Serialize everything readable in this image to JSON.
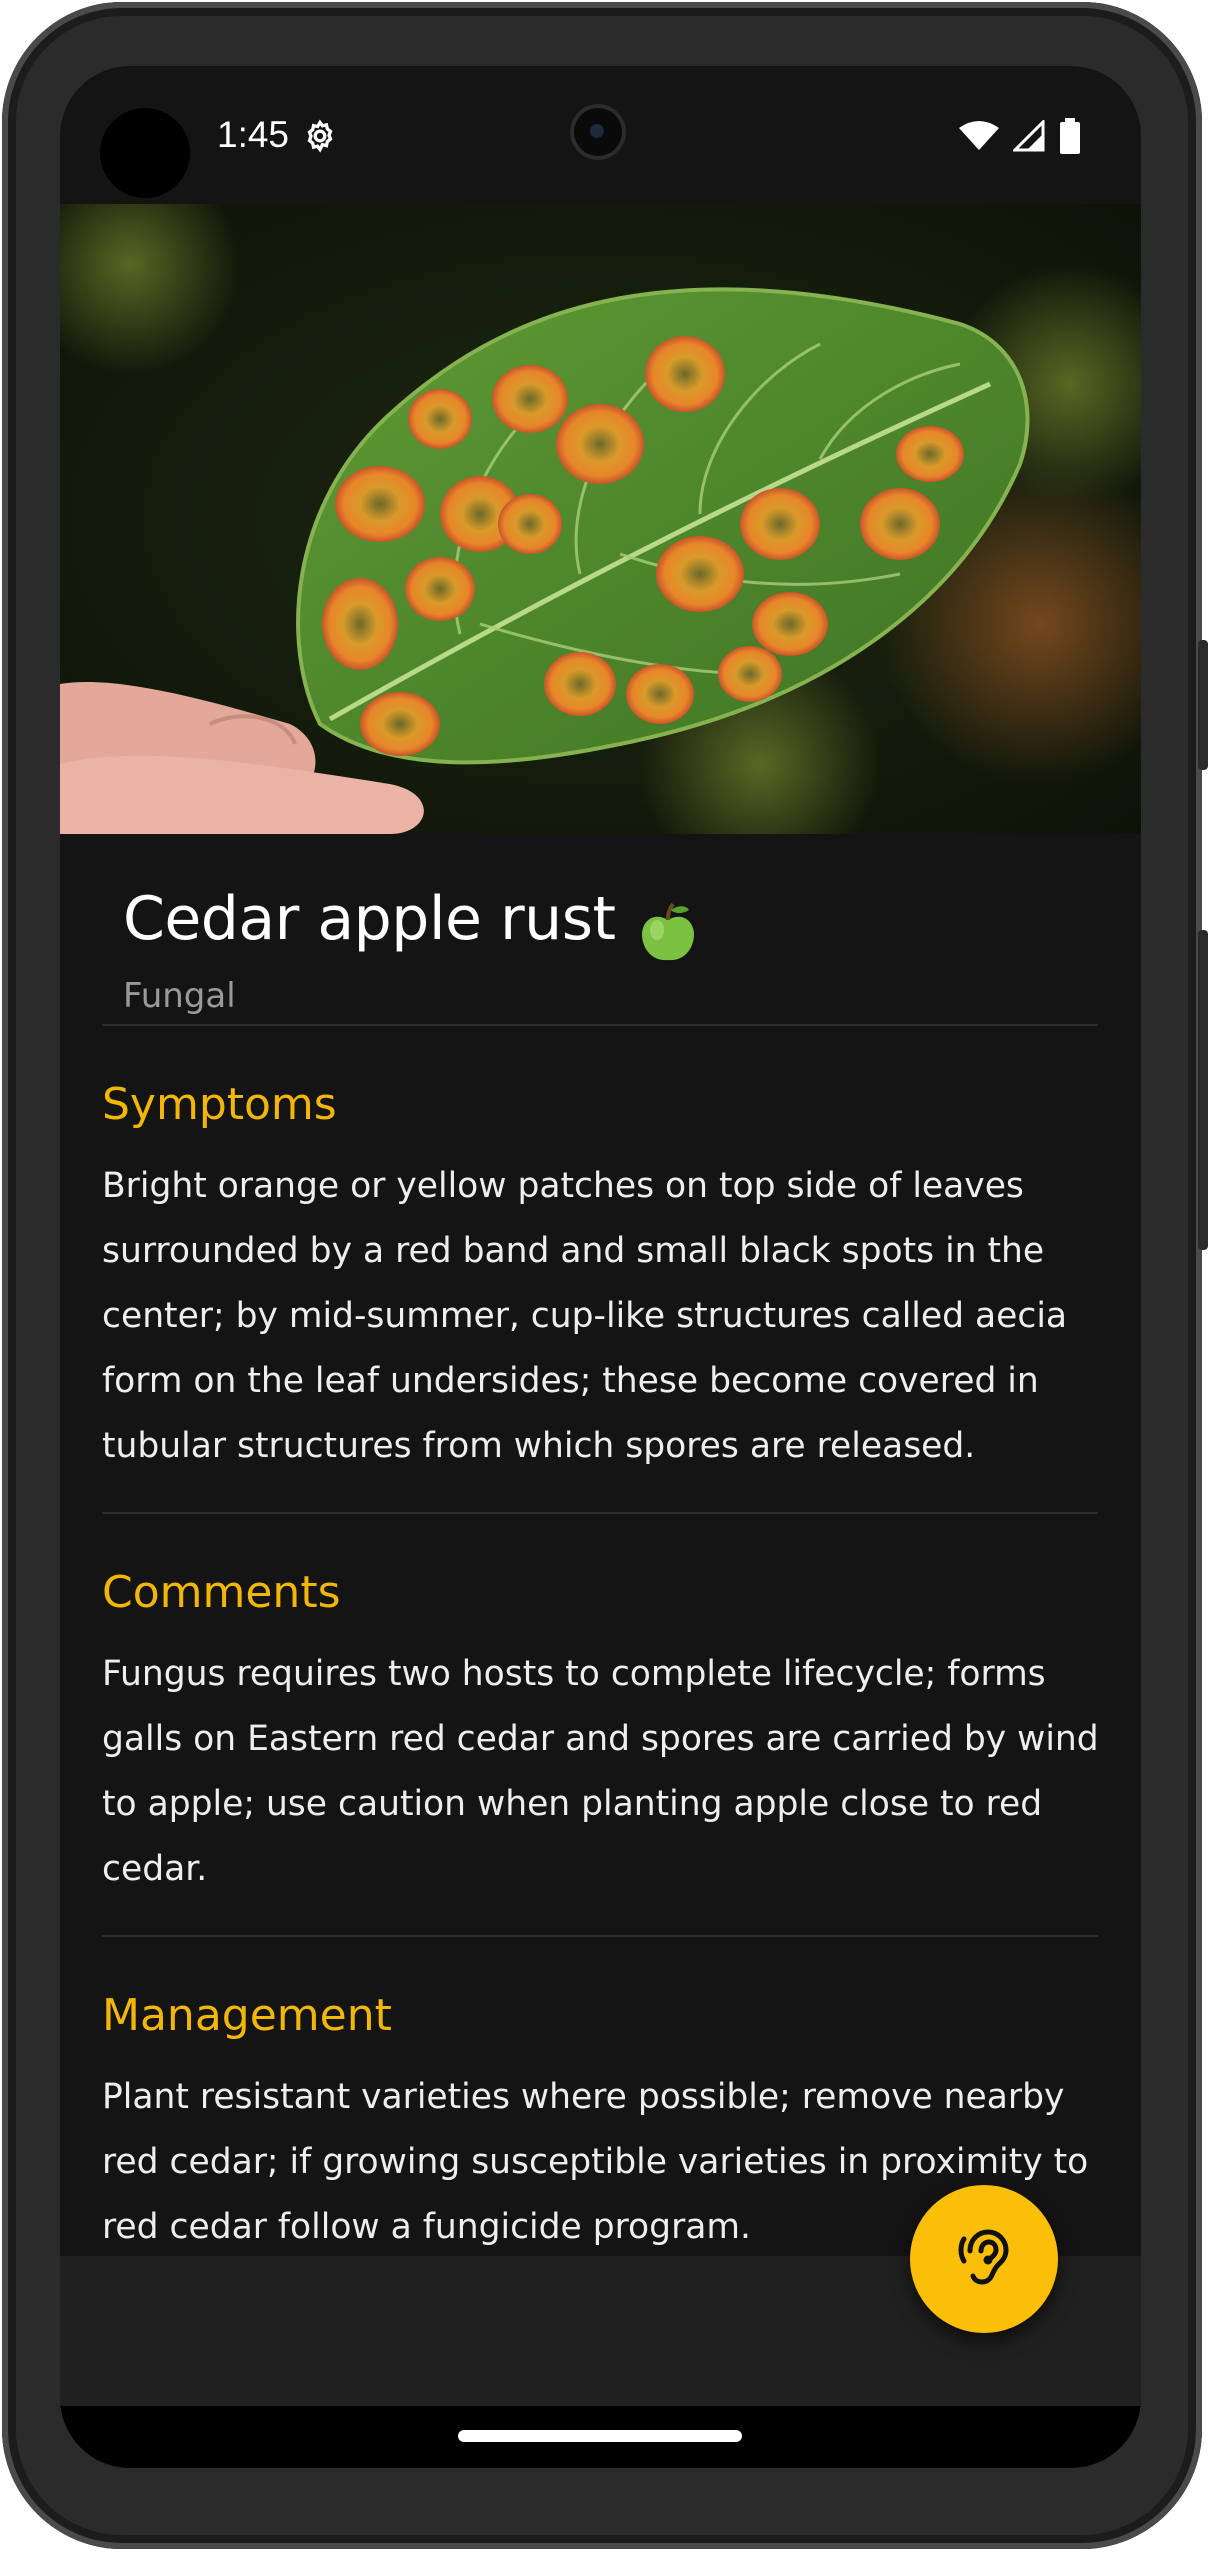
{
  "status_bar": {
    "time": "1:45",
    "icons": [
      "settings-gear-icon",
      "wifi-icon",
      "cell-signal-icon",
      "battery-icon"
    ]
  },
  "hero": {
    "image_subject": "leaf-with-rust-spots"
  },
  "disease": {
    "title": "Cedar apple rust",
    "title_emoji": "green-apple-icon",
    "category": "Fungal"
  },
  "sections": [
    {
      "heading": "Symptoms",
      "body": "Bright orange or yellow patches on top side of leaves surrounded by a red band and small black spots in the center; by mid-summer, cup-like structures called aecia form on the leaf undersides; these become covered in tubular structures from which spores are released."
    },
    {
      "heading": "Comments",
      "body": "Fungus requires two hosts to complete lifecycle; forms galls on Eastern red cedar and spores are carried by wind to apple; use caution when planting apple close to red cedar."
    },
    {
      "heading": "Management",
      "body": "Plant resistant varieties where possible; remove nearby red cedar; if growing susceptible varieties in proximity to red cedar follow a fungicide program."
    }
  ],
  "fab": {
    "icon": "hearing-ear-icon"
  },
  "colors": {
    "accent": "#f2b705",
    "fab": "#fbbf0a",
    "background": "#141414",
    "text": "#eeeeee",
    "muted": "#9a9a9a"
  }
}
